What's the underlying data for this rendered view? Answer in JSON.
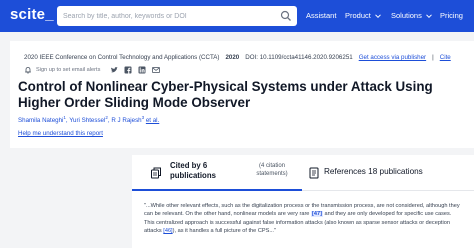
{
  "header": {
    "logo": "scite_",
    "search_placeholder": "Search by title, author, keywords or DOI",
    "nav": [
      {
        "label": "Assistant",
        "has_dropdown": false
      },
      {
        "label": "Product",
        "has_dropdown": true
      },
      {
        "label": "Solutions",
        "has_dropdown": true
      },
      {
        "label": "Pricing",
        "has_dropdown": false
      }
    ]
  },
  "paper": {
    "conference": "2020 IEEE Conference on Control Technology and Applications (CCTA)",
    "year": "2020",
    "doi": "DOI: 10.1109/ccta41146.2020.9206251",
    "access_link": "Get access via publisher",
    "cite_link": "Cite",
    "alert_text": "Sign up to set email alerts",
    "title": "Control of Nonlinear Cyber-Physical Systems under Attack Using Higher Order Sliding Mode Observer",
    "authors": [
      {
        "name": "Shamila Nateghi",
        "sup": "1"
      },
      {
        "name": "Yuri Shtessel",
        "sup": "2"
      },
      {
        "name": "R J Rajesh",
        "sup": "3"
      }
    ],
    "et_al": "et al.",
    "help_link": "Help me understand this report"
  },
  "tabs": {
    "cited_main": "Cited by 6 publications",
    "cited_sub": "(4 citation statements)",
    "refs_main": "References 18 publications"
  },
  "citation": {
    "text_before": "\"...While other relevant effects, such as the digitalization process or the transmission process, are not considered, although they can be relevant. On the other hand, nonlinear models are very rare ",
    "ref1": "[47]",
    "text_middle": " and they are only developed for specific use cases. This centralized approach is successful against false information attacks (also known as sparse sensor attacks or deception attacks ",
    "ref2": "[46]",
    "text_after": "), as it handles a full picture of the CPS...\""
  },
  "colors": {
    "brand": "#1d4ed8",
    "background": "#f3f4f6"
  },
  "icons": [
    "search-icon",
    "chevron-down-icon",
    "bell-icon",
    "twitter-icon",
    "facebook-icon",
    "linkedin-icon",
    "email-icon",
    "cited-by-icon",
    "references-icon"
  ]
}
